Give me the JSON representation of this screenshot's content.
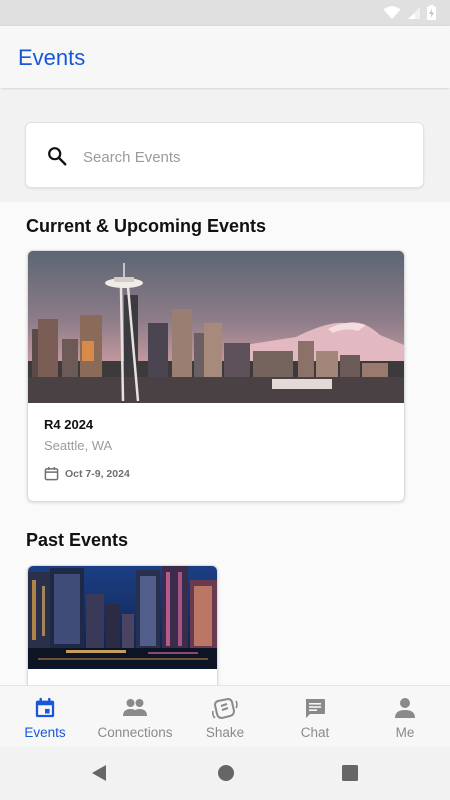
{
  "app": {
    "title": "Events"
  },
  "search": {
    "placeholder": "Search Events",
    "value": ""
  },
  "sections": {
    "current_title": "Current & Upcoming Events",
    "past_title": "Past Events"
  },
  "current_events": [
    {
      "name": "R4 2024",
      "location": "Seattle, WA",
      "date": "Oct 7-9, 2024"
    }
  ],
  "bottom_nav": {
    "items": [
      {
        "label": "Events",
        "icon": "calendar-icon",
        "active": true
      },
      {
        "label": "Connections",
        "icon": "people-icon",
        "active": false
      },
      {
        "label": "Shake",
        "icon": "shake-hand-icon",
        "active": false
      },
      {
        "label": "Chat",
        "icon": "chat-bubble-icon",
        "active": false
      },
      {
        "label": "Me",
        "icon": "person-icon",
        "active": false
      }
    ]
  },
  "colors": {
    "accent": "#1a56db",
    "inactive": "#8a8a8a"
  }
}
